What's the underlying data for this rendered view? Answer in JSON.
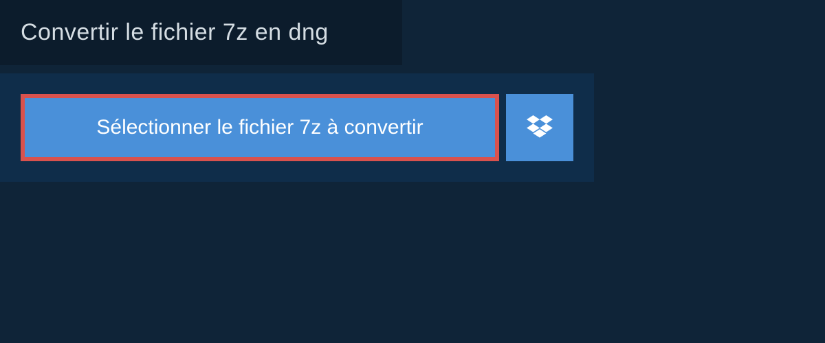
{
  "header": {
    "title": "Convertir le fichier 7z en dng"
  },
  "upload": {
    "select_button_label": "Sélectionner le fichier 7z à convertir"
  },
  "colors": {
    "page_bg": "#0f2438",
    "header_bg": "#0c1c2c",
    "container_bg": "#0f2d4a",
    "button_bg": "#4a90d9",
    "button_border": "#d9524e",
    "text_light": "#d5dde3",
    "text_white": "#ffffff"
  }
}
